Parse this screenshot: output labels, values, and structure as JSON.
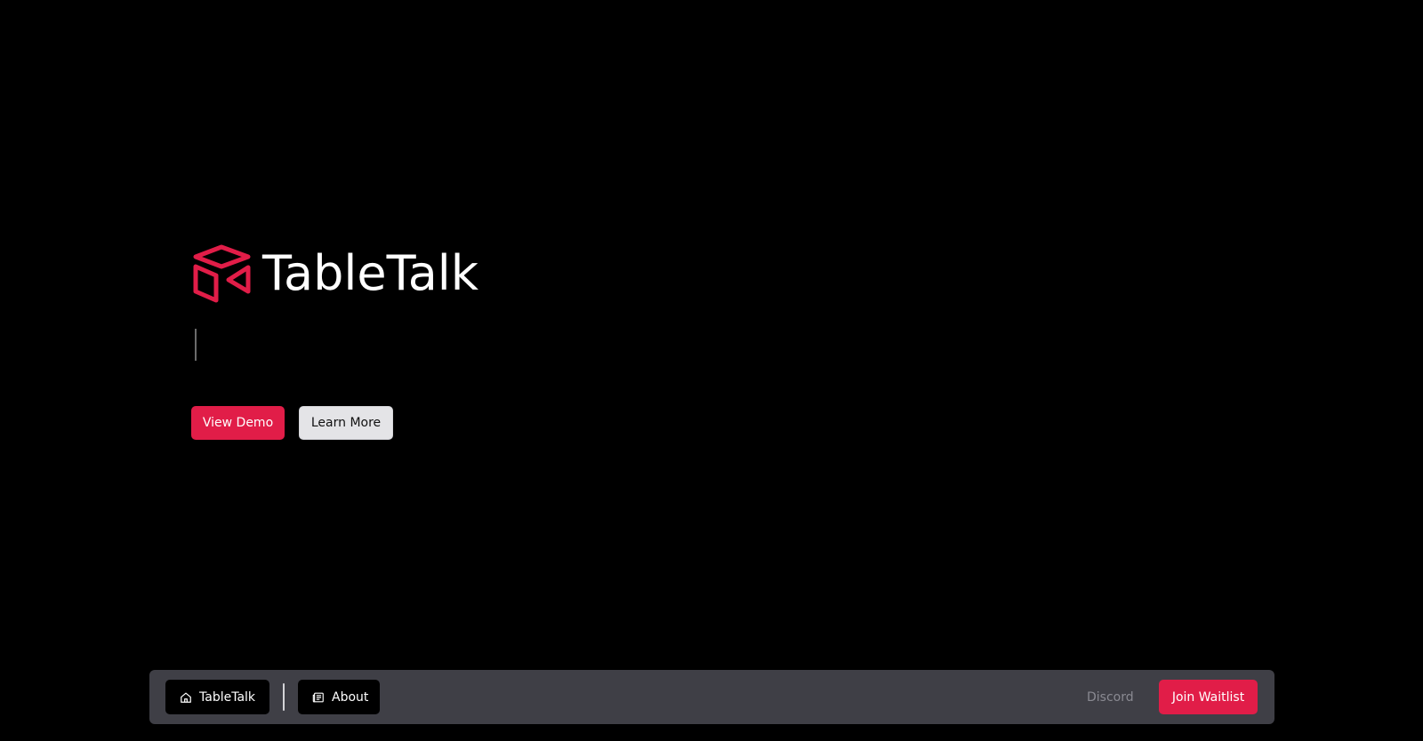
{
  "theme": {
    "background": "#000000",
    "accent": "#e11d48",
    "secondary_button_bg": "#e4e4e7",
    "dock_bg": "#3f3f46",
    "muted_text": "#8a8a92"
  },
  "hero": {
    "logo_icon": "open-box-icon",
    "brand_title": "TableTalk",
    "typed_text": "",
    "primary_cta": "View Demo",
    "secondary_cta": "Learn More"
  },
  "dock": {
    "home": {
      "icon": "home-icon",
      "label": "TableTalk"
    },
    "about": {
      "icon": "newspaper-icon",
      "label": "About"
    },
    "discord_label": "Discord",
    "waitlist_label": "Join Waitlist"
  }
}
